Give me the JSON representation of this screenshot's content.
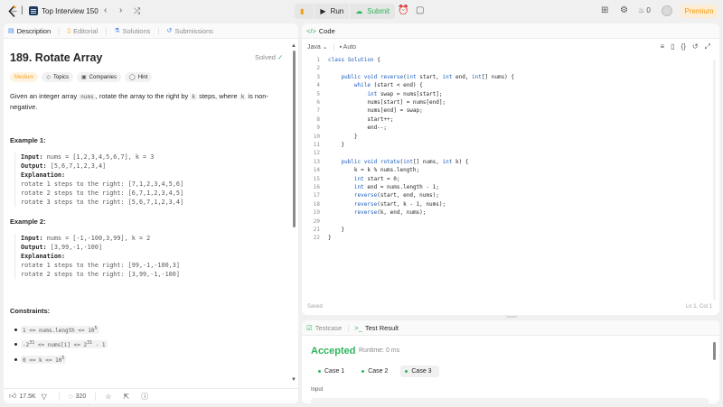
{
  "topbar": {
    "list_title": "Top Interview 150",
    "run_label": "Run",
    "submit_label": "Submit",
    "streak_count": "0",
    "premium_label": "Premium"
  },
  "left": {
    "tabs": [
      "Description",
      "Editorial",
      "Solutions",
      "Submissions"
    ],
    "title": "189. Rotate Array",
    "status": "Solved",
    "tags": [
      "Medium",
      "Topics",
      "Companies",
      "Hint"
    ],
    "desc_1": "Given an integer array ",
    "desc_nums": "nums",
    "desc_2": ", rotate the array to the right by ",
    "desc_k": "k",
    "desc_3": " steps, where ",
    "desc_k2": "k",
    "desc_4": " is non-negative.",
    "examples": [
      {
        "title": "Example 1:",
        "input_label": "Input:",
        "input": " nums = [1,2,3,4,5,6,7], k = 3",
        "output_label": "Output:",
        "output": " [5,6,7,1,2,3,4]",
        "expl_label": "Explanation:",
        "lines": [
          "rotate 1 steps to the right: [7,1,2,3,4,5,6]",
          "rotate 2 steps to the right: [6,7,1,2,3,4,5]",
          "rotate 3 steps to the right: [5,6,7,1,2,3,4]"
        ]
      },
      {
        "title": "Example 2:",
        "input_label": "Input:",
        "input": " nums = [-1,-100,3,99], k = 2",
        "output_label": "Output:",
        "output": " [3,99,-1,-100]",
        "expl_label": "Explanation:",
        "lines": [
          "rotate 1 steps to the right: [99,-1,-100,3]",
          "rotate 2 steps to the right: [3,99,-1,-100]"
        ]
      }
    ],
    "constraints_title": "Constraints:",
    "constraints": [
      {
        "a": "1 <= nums.length <= 10",
        "sup": "5",
        "b": ""
      },
      {
        "a": "-2",
        "sup": "31",
        "b": " <= nums[i] <= 2",
        "sup2": "31",
        "c": " - 1"
      },
      {
        "a": "0 <= k <= 10",
        "sup": "5",
        "b": ""
      }
    ],
    "likes": "17.5K",
    "comments": "320"
  },
  "code": {
    "header": "Code",
    "language": "Java",
    "mode": "Auto",
    "lines": [
      {
        "n": "1",
        "t": "class Solution {"
      },
      {
        "n": "2",
        "t": ""
      },
      {
        "n": "3",
        "t": "    public void reverse(int start, int end, int[] nums) {"
      },
      {
        "n": "4",
        "t": "        while (start < end) {"
      },
      {
        "n": "5",
        "t": "            int swap = nums[start];"
      },
      {
        "n": "6",
        "t": "            nums[start] = nums[end];"
      },
      {
        "n": "7",
        "t": "            nums[end] = swap;"
      },
      {
        "n": "8",
        "t": "            start++;"
      },
      {
        "n": "9",
        "t": "            end--;"
      },
      {
        "n": "10",
        "t": "        }"
      },
      {
        "n": "11",
        "t": "    }"
      },
      {
        "n": "12",
        "t": ""
      },
      {
        "n": "13",
        "t": "    public void rotate(int[] nums, int k) {"
      },
      {
        "n": "14",
        "t": "        k = k % nums.length;"
      },
      {
        "n": "15",
        "t": "        int start = 0;"
      },
      {
        "n": "16",
        "t": "        int end = nums.length - 1;"
      },
      {
        "n": "17",
        "t": "        reverse(start, end, nums);"
      },
      {
        "n": "18",
        "t": "        reverse(start, k - 1, nums);"
      },
      {
        "n": "19",
        "t": "        reverse(k, end, nums);"
      },
      {
        "n": "20",
        "t": ""
      },
      {
        "n": "21",
        "t": "    }"
      },
      {
        "n": "22",
        "t": "}"
      }
    ],
    "saved": "Saved",
    "cursor": "Ln 1, Col 1"
  },
  "bottom": {
    "tabs": [
      "Testcase",
      "Test Result"
    ],
    "result": "Accepted",
    "runtime": "Runtime: 0 ms",
    "cases": [
      "Case 1",
      "Case 2",
      "Case 3"
    ],
    "input_label": "Input"
  },
  "colors": {
    "accent_green": "#2db55d",
    "brand_blue": "#3b82f6",
    "premium": "#f59e0b"
  }
}
